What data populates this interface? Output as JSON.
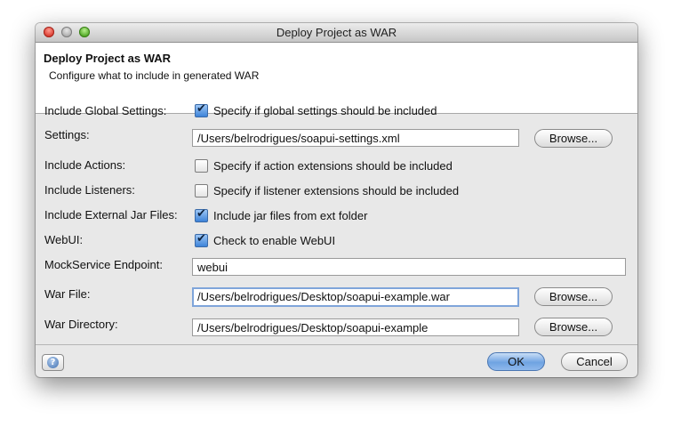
{
  "window": {
    "title": "Deploy Project as WAR"
  },
  "header": {
    "title": "Deploy Project as WAR",
    "description": "Configure what to include in generated WAR"
  },
  "form": {
    "global_settings": {
      "label": "Include Global Settings:",
      "checkbox_label": "Specify if global settings should be included",
      "checked": true
    },
    "settings": {
      "label": "Settings:",
      "value": "/Users/belrodrigues/soapui-settings.xml",
      "browse_label": "Browse..."
    },
    "actions": {
      "label": "Include Actions:",
      "checkbox_label": "Specify if action extensions should be included",
      "checked": false
    },
    "listeners": {
      "label": "Include Listeners:",
      "checkbox_label": "Specify if listener extensions should be included",
      "checked": false
    },
    "ext_jars": {
      "label": "Include External Jar Files:",
      "checkbox_label": "Include jar files from ext folder",
      "checked": true
    },
    "webui": {
      "label": "WebUI:",
      "checkbox_label": "Check to enable WebUI",
      "checked": true
    },
    "mock_endpoint": {
      "label": "MockService Endpoint:",
      "value": "webui"
    },
    "war_file": {
      "label": "War File:",
      "value": "/Users/belrodrigues/Desktop/soapui-example.war",
      "browse_label": "Browse..."
    },
    "war_directory": {
      "label": "War Directory:",
      "value": "/Users/belrodrigues/Desktop/soapui-example",
      "browse_label": "Browse..."
    }
  },
  "footer": {
    "help_icon": "?",
    "ok_label": "OK",
    "cancel_label": "Cancel"
  },
  "colors": {
    "default_button": "#6fa3e2",
    "focus_ring": "#7fa5da",
    "close_button": "#d8362a",
    "zoom_button": "#4aa31f"
  }
}
